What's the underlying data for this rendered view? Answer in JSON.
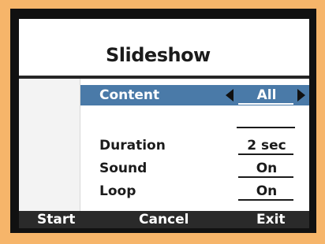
{
  "title": "Slideshow",
  "rows": [
    {
      "label": "Content",
      "value": "All"
    },
    {
      "label": "Duration",
      "value": "2 sec"
    },
    {
      "label": "Sound",
      "value": "On"
    },
    {
      "label": "Loop",
      "value": "On"
    }
  ],
  "footer": {
    "start": "Start",
    "cancel": "Cancel",
    "exit": "Exit"
  },
  "colors": {
    "selected": "#4a7aa8",
    "frame": "#f6b56a",
    "bezel": "#111111"
  }
}
